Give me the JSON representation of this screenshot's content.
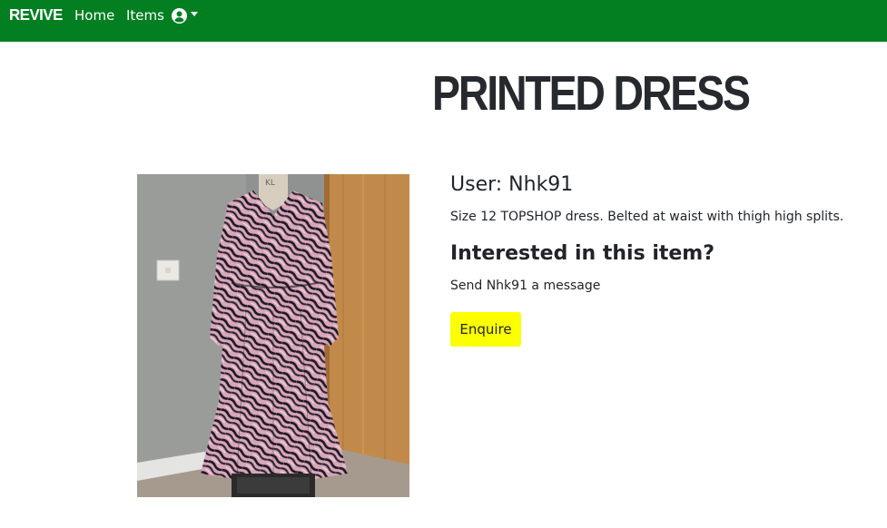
{
  "navbar": {
    "brand": "REVIVE",
    "links": [
      {
        "label": "Home"
      },
      {
        "label": "Items"
      }
    ],
    "user_menu_icon": "user-circle-icon",
    "background_color": "#037f22"
  },
  "product": {
    "title": "PRINTED DRESS",
    "user_line": "User: Nhk91",
    "description": "Size 12 TOPSHOP dress. Belted at waist with thigh high splits.",
    "interest_heading": "Interested in this item?",
    "send_message": "Send Nhk91 a message",
    "enquire_label": "Enquire",
    "enquire_color": "#fbff00"
  }
}
